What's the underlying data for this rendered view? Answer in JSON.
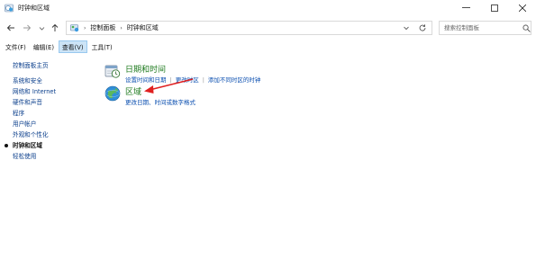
{
  "window": {
    "title": "时钟和区域",
    "controls": {
      "minimize": "—",
      "maximize": "☐",
      "close": "✕"
    }
  },
  "address": {
    "crumbs": [
      "控制面板",
      "时钟和区域"
    ],
    "search_placeholder": "搜索控制面板"
  },
  "menubar": {
    "items": [
      {
        "label": "文件(F)",
        "active": false
      },
      {
        "label": "编辑(E)",
        "active": false
      },
      {
        "label": "查看(V)",
        "active": true
      },
      {
        "label": "工具(T)",
        "active": false
      }
    ]
  },
  "sidebar": {
    "home": "控制面板主页",
    "items": [
      {
        "label": "系统和安全"
      },
      {
        "label": "网络和 Internet"
      },
      {
        "label": "硬件和声音"
      },
      {
        "label": "程序"
      },
      {
        "label": "用户帐户"
      },
      {
        "label": "外观和个性化"
      },
      {
        "label": "时钟和区域"
      },
      {
        "label": "轻松使用"
      }
    ]
  },
  "main": {
    "categories": [
      {
        "title": "日期和时间",
        "links": [
          "设置时间和日期",
          "更改时区",
          "添加不同时区的时钟"
        ]
      },
      {
        "title": "区域",
        "links": [
          "更改日期、时间或数字格式"
        ]
      }
    ]
  },
  "colors": {
    "category_title": "#1e7a1e",
    "link": "#0b4fb0",
    "annotation_arrow": "#e02020"
  }
}
